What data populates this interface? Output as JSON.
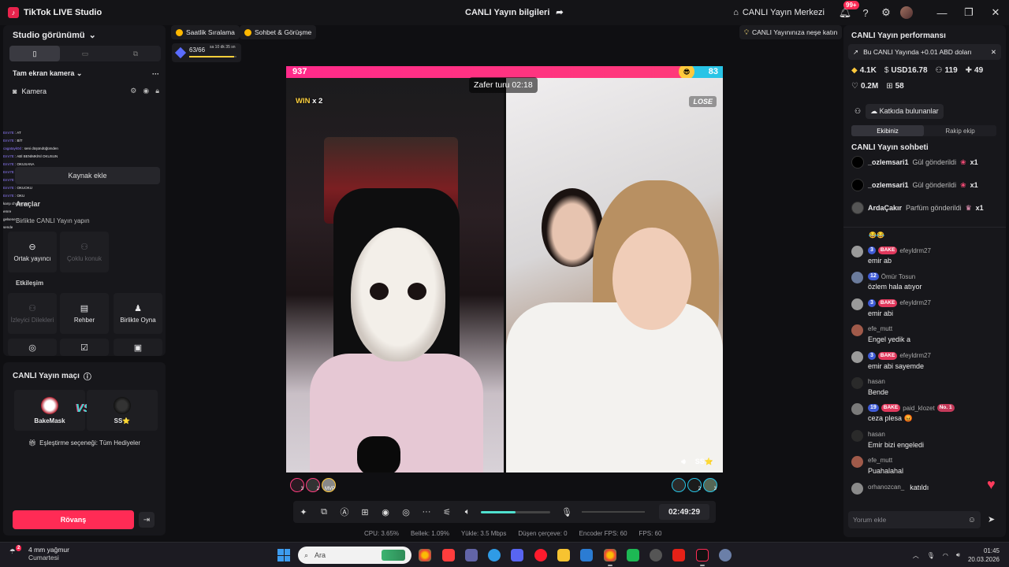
{
  "app": {
    "title": "TikTok LIVE Studio",
    "logo_icon": "tiktok-logo-icon",
    "center_title": "CANLI Yayın bilgileri",
    "live_center": "CANLI Yayın Merkezi",
    "notif_badge": "99+"
  },
  "left": {
    "studio_view": "Studio görünümü",
    "scene": "Tam ekran kamera",
    "camera": "Kamera",
    "add_source": "Kaynak ekle",
    "tools_label": "Araçlar",
    "collab_label": "Birlikte CANLI Yayın yapın",
    "collab_tiles": [
      {
        "label": "Ortak yayıncı",
        "dim": false
      },
      {
        "label": "Çoklu konuk",
        "dim": true
      }
    ],
    "interaction_label": "Etkileşim",
    "interaction_tiles": [
      {
        "label": "İzleyici Dilekleri",
        "dim": true
      },
      {
        "label": "Rehber",
        "dim": false
      },
      {
        "label": "Birlikte Oyna",
        "dim": false
      }
    ],
    "overlay_chat": [
      {
        "u": "Emr7E",
        "t": ": AT"
      },
      {
        "u": "Emr7E",
        "t": ": BİT"
      },
      {
        "u": "cagatayk0d",
        "t": ": seni düşündüğümden"
      },
      {
        "u": "Emr7E",
        "t": ": ABİ BENİMKİNİ OKUSUN"
      },
      {
        "u": "Emr7E",
        "t": ": OKUSANA"
      },
      {
        "u": "Emr7E",
        "t": ": ABGİ"
      },
      {
        "u": "Emr7E",
        "t": ": ABİ"
      },
      {
        "u": "Emr7E",
        "t": ": OKUOKU"
      },
      {
        "u": "Emr7E",
        "t": ": OKU"
      },
      {
        "u": "",
        "t": "karşı chuate gel"
      },
      {
        "u": "",
        "t": "emre"
      },
      {
        "u": "",
        "t": "gelsene"
      },
      {
        "u": "",
        "t": "sende"
      }
    ]
  },
  "match": {
    "title": "CANLI Yayın maçı",
    "player1": "BakeMask",
    "player2": "SS⭐",
    "vs": "VS",
    "option": "Eşleştirme seçeneği: Tüm Hediyeler",
    "rematch": "Rövanş"
  },
  "chips": {
    "ranking": "Saatlik Sıralama",
    "chat_meet": "Sohbet & Görüşme",
    "tip": "CANLI Yayınınıza neşe katın",
    "goal_count": "63/66",
    "goal_time": "sa 10 dk 35 sn",
    "goal_progress": 0.95
  },
  "battle": {
    "score_left": "937",
    "score_right": "83",
    "score_left_share": 0.919,
    "win_label": "WIN",
    "win_mult": "x 2",
    "lose_label": "LOSE",
    "round_timer": "Zafer turu 02:18",
    "opponent": "SS⭐",
    "left_viewers": [
      "3",
      "2",
      "MVP"
    ],
    "right_viewers": [
      "",
      "2",
      "3"
    ]
  },
  "controls": {
    "volume": 0.5,
    "timer": "02:49:29"
  },
  "stats": {
    "cpu": "CPU:  3.65%",
    "mem": "Bellek:  1.09%",
    "upload": "Yükle:  3.5 Mbps",
    "dropped": "Düşen çerçeve:  0",
    "encoder_fps": "Encoder FPS:  60",
    "fps": "FPS:  60"
  },
  "right": {
    "perf_title": "CANLI Yayın performansı",
    "banner": "Bu CANLI Yayında +0.01 ABD doları",
    "diamonds": "4.1K",
    "usd": "USD16.78",
    "viewers": "119",
    "new_followers": "49",
    "likes": "0.2M",
    "gifters": "58",
    "contributors": "Katkıda bulunanlar",
    "tab_us": "Ekibiniz",
    "tab_rival": "Rakip ekip",
    "chat_title": "CANLI Yayın sohbeti",
    "gifts": [
      {
        "user": "_ozlemsari1",
        "text": "Gül gönderildi",
        "count": "x1",
        "icon": "rose-icon"
      },
      {
        "user": "_ozlemsari1",
        "text": "Gül gönderildi",
        "count": "x1",
        "icon": "rose-icon"
      },
      {
        "user": "ArdaÇakır",
        "text": "Parfüm gönderildi",
        "count": "x1",
        "icon": "perfume-icon"
      }
    ],
    "emoji_line": "😂😂",
    "messages": [
      {
        "user": "efeyldrm27",
        "level": "3",
        "fan": "BAKE",
        "no1": "",
        "text": "emir ab"
      },
      {
        "user": "Ömür Tosun",
        "level": "12",
        "fan": "",
        "no1": "",
        "text": "özlem hala atıyor"
      },
      {
        "user": "efeyldrm27",
        "level": "3",
        "fan": "BAKE",
        "no1": "",
        "text": "emir abi"
      },
      {
        "user": "efe_mutt",
        "level": "",
        "fan": "",
        "no1": "",
        "text": "Engel yedik a"
      },
      {
        "user": "efeyldrm27",
        "level": "3",
        "fan": "BAKE",
        "no1": "",
        "text": "emir abi sayemde"
      },
      {
        "user": "hasan",
        "level": "",
        "fan": "",
        "no1": "",
        "text": "Bende"
      },
      {
        "user": "paid_klozet",
        "level": "19",
        "fan": "BAKE",
        "no1": "No. 1",
        "text": "ceza plesa 😡"
      },
      {
        "user": "hasan",
        "level": "",
        "fan": "",
        "no1": "",
        "text": "Emir bizi engeledi"
      },
      {
        "user": "efe_mutt",
        "level": "",
        "fan": "",
        "no1": "",
        "text": "Puahalahal"
      },
      {
        "user": "orhanozcan_",
        "level": "",
        "fan": "",
        "no1": "",
        "text": "katıldı"
      }
    ],
    "comment_placeholder": "Yorum ekle"
  },
  "taskbar": {
    "weather_temp": "4 mm yağmur",
    "weather_day": "Cumartesi",
    "weather_badge": "2",
    "search_placeholder": "Ara",
    "time": "01:45",
    "date": "20.03.2026"
  },
  "colors": {
    "accent": "#ff2b55",
    "left_score": "#ff2a8a",
    "right_score": "#28c4e6",
    "teal": "#4fe0cf"
  }
}
